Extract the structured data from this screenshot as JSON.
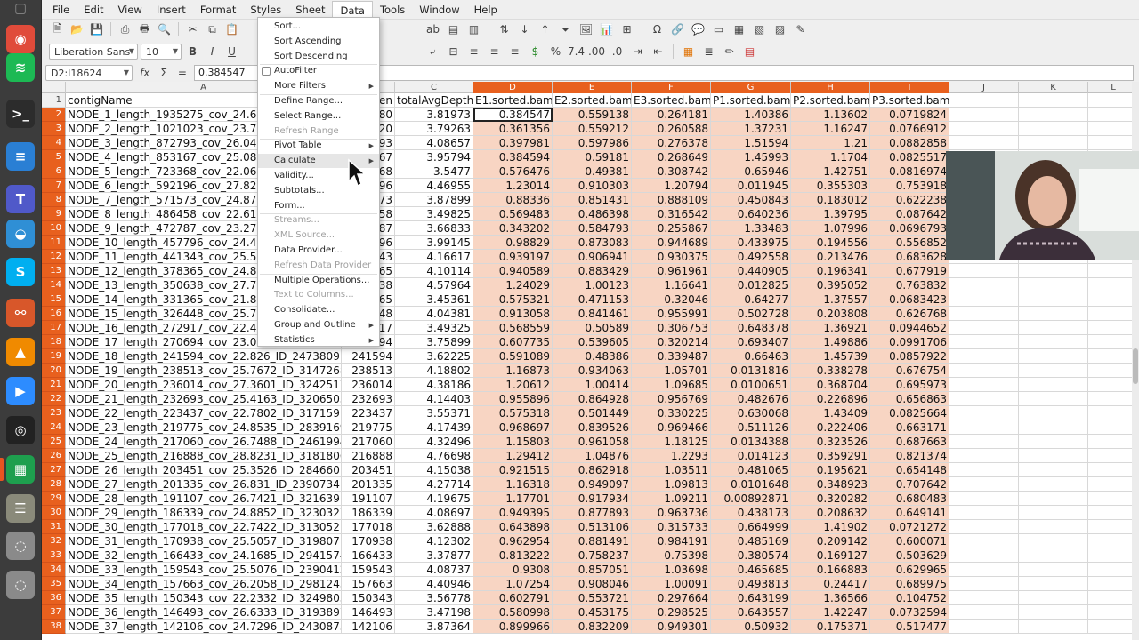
{
  "dock": {
    "items": [
      {
        "name": "files-icon",
        "glyph": "▢",
        "color": "#5a5a5a"
      },
      {
        "name": "chrome-icon",
        "glyph": "◉",
        "color": "#e04b3a"
      },
      {
        "name": "spotify-icon",
        "glyph": "≋",
        "color": "#1db954"
      },
      {
        "name": "terminal-icon",
        "glyph": ">_",
        "color": "#2c2c2c"
      },
      {
        "name": "writer-icon",
        "glyph": "≡",
        "color": "#2a7fd4"
      },
      {
        "name": "teams-icon",
        "glyph": "T",
        "color": "#5059c9"
      },
      {
        "name": "remote-icon",
        "glyph": "◒",
        "color": "#2f8fd5"
      },
      {
        "name": "skype-icon",
        "glyph": "S",
        "color": "#00aff0"
      },
      {
        "name": "network-icon",
        "glyph": "⚯",
        "color": "#d8572a"
      },
      {
        "name": "vlc-icon",
        "glyph": "▲",
        "color": "#f08a00"
      },
      {
        "name": "zoom-icon",
        "glyph": "▶",
        "color": "#2d8cff"
      },
      {
        "name": "obs-icon",
        "glyph": "◎",
        "color": "#222222"
      },
      {
        "name": "calc-icon",
        "glyph": "▦",
        "color": "#1e9f4e"
      },
      {
        "name": "archive-icon",
        "glyph": "☰",
        "color": "#8a8a7a"
      },
      {
        "name": "disk-icon",
        "glyph": "◌",
        "color": "#8a8a8a"
      },
      {
        "name": "disk2-icon",
        "glyph": "◌",
        "color": "#8a8a8a"
      }
    ]
  },
  "menubar": [
    "File",
    "Edit",
    "View",
    "Insert",
    "Format",
    "Styles",
    "Sheet",
    "Data",
    "Tools",
    "Window",
    "Help"
  ],
  "font": {
    "name": "Liberation Sans",
    "size": "10"
  },
  "formula": {
    "namebox": "D2:I18624",
    "symbols": "Σ",
    "equals": "=",
    "value": "0.384547"
  },
  "columns": [
    {
      "label": "A",
      "selected": false
    },
    {
      "label": "B",
      "selected": false
    },
    {
      "label": "C",
      "selected": false
    },
    {
      "label": "D",
      "selected": true
    },
    {
      "label": "E",
      "selected": true
    },
    {
      "label": "F",
      "selected": true
    },
    {
      "label": "G",
      "selected": true
    },
    {
      "label": "H",
      "selected": true
    },
    {
      "label": "I",
      "selected": true
    },
    {
      "label": "J",
      "selected": false
    },
    {
      "label": "K",
      "selected": false
    },
    {
      "label": "L",
      "selected": false
    }
  ],
  "header_row": [
    "contigName",
    "en",
    "totalAvgDepth",
    "E1.sorted.bam",
    "E2.sorted.bam",
    "E3.sorted.bam",
    "P1.sorted.bam",
    "P2.sorted.bam",
    "P3.sorted.bam"
  ],
  "rows": [
    [
      "NODE_1_length_1935275_cov_24.6",
      "280",
      "3.81973",
      "0.384547",
      "0.559138",
      "0.264181",
      "1.40386",
      "1.13602",
      "0.0719824"
    ],
    [
      "NODE_2_length_1021023_cov_23.7",
      "020",
      "3.79263",
      "0.361356",
      "0.559212",
      "0.260588",
      "1.37231",
      "1.16247",
      "0.0766912"
    ],
    [
      "NODE_3_length_872793_cov_26.04",
      "793",
      "4.08657",
      "0.397981",
      "0.597986",
      "0.276378",
      "1.51594",
      "1.21",
      "0.0882858"
    ],
    [
      "NODE_4_length_853167_cov_25.08",
      "167",
      "3.95794",
      "0.384594",
      "0.59181",
      "0.268649",
      "1.45993",
      "1.1704",
      "0.0825517"
    ],
    [
      "NODE_5_length_723368_cov_22.06",
      "368",
      "3.5477",
      "0.576476",
      "0.49381",
      "0.308742",
      "0.65946",
      "1.42751",
      "0.0816974"
    ],
    [
      "NODE_6_length_592196_cov_27.82",
      "196",
      "4.46955",
      "1.23014",
      "0.910303",
      "1.20794",
      "0.011945",
      "0.355303",
      "0.753918"
    ],
    [
      "NODE_7_length_571573_cov_24.87",
      "573",
      "3.87899",
      "0.88336",
      "0.851431",
      "0.888109",
      "0.450843",
      "0.183012",
      "0.622238"
    ],
    [
      "NODE_8_length_486458_cov_22.61",
      "458",
      "3.49825",
      "0.569483",
      "0.486398",
      "0.316542",
      "0.640236",
      "1.39795",
      "0.087642"
    ],
    [
      "NODE_9_length_472787_cov_23.27",
      "787",
      "3.66833",
      "0.343202",
      "0.584793",
      "0.255867",
      "1.33483",
      "1.07996",
      "0.0696793"
    ],
    [
      "NODE_10_length_457796_cov_24.4",
      "796",
      "3.99145",
      "0.98829",
      "0.873083",
      "0.944689",
      "0.433975",
      "0.194556",
      "0.556852"
    ],
    [
      "NODE_11_length_441343_cov_25.5",
      "343",
      "4.16617",
      "0.939197",
      "0.906941",
      "0.930375",
      "0.492558",
      "0.213476",
      "0.683628"
    ],
    [
      "NODE_12_length_378365_cov_24.8",
      "365",
      "4.10114",
      "0.940589",
      "0.883429",
      "0.961961",
      "0.440905",
      "0.196341",
      "0.677919"
    ],
    [
      "NODE_13_length_350638_cov_27.7",
      "638",
      "4.57964",
      "1.24029",
      "1.00123",
      "1.16641",
      "0.012825",
      "0.395052",
      "0.763832"
    ],
    [
      "NODE_14_length_331365_cov_21.8",
      "365",
      "3.45361",
      "0.575321",
      "0.471153",
      "0.32046",
      "0.64277",
      "1.37557",
      "0.0683423"
    ],
    [
      "NODE_15_length_326448_cov_25.7",
      "448",
      "4.04381",
      "0.913058",
      "0.841461",
      "0.955991",
      "0.502728",
      "0.203808",
      "0.626768"
    ],
    [
      "NODE_16_length_272917_cov_22.4",
      "917",
      "3.49325",
      "0.568559",
      "0.50589",
      "0.306753",
      "0.648378",
      "1.36921",
      "0.0944652"
    ],
    [
      "NODE_17_length_270694_cov_23.0",
      "594",
      "3.75899",
      "0.607735",
      "0.539605",
      "0.320214",
      "0.693407",
      "1.49886",
      "0.0991706"
    ],
    [
      "NODE_18_length_241594_cov_22.826_ID_2473809",
      "241594",
      "3.62225",
      "0.591089",
      "0.48386",
      "0.339487",
      "0.66463",
      "1.45739",
      "0.0857922"
    ],
    [
      "NODE_19_length_238513_cov_25.7672_ID_3147268",
      "238513",
      "4.18802",
      "1.16873",
      "0.934063",
      "1.05701",
      "0.0131816",
      "0.338278",
      "0.676754"
    ],
    [
      "NODE_20_length_236014_cov_27.3601_ID_3242517",
      "236014",
      "4.38186",
      "1.20612",
      "1.00414",
      "1.09685",
      "0.0100651",
      "0.368704",
      "0.695973"
    ],
    [
      "NODE_21_length_232693_cov_25.4163_ID_3206503",
      "232693",
      "4.14403",
      "0.955896",
      "0.864928",
      "0.956769",
      "0.482676",
      "0.226896",
      "0.656863"
    ],
    [
      "NODE_22_length_223437_cov_22.7802_ID_3171591",
      "223437",
      "3.55371",
      "0.575318",
      "0.501449",
      "0.330225",
      "0.630068",
      "1.43409",
      "0.0825664"
    ],
    [
      "NODE_23_length_219775_cov_24.8535_ID_2839169",
      "219775",
      "4.17439",
      "0.968697",
      "0.839526",
      "0.969466",
      "0.511126",
      "0.222406",
      "0.663171"
    ],
    [
      "NODE_24_length_217060_cov_26.7488_ID_2461994",
      "217060",
      "4.32496",
      "1.15803",
      "0.961058",
      "1.18125",
      "0.0134388",
      "0.323526",
      "0.687663"
    ],
    [
      "NODE_25_length_216888_cov_28.8231_ID_3181806",
      "216888",
      "4.76698",
      "1.29412",
      "1.04876",
      "1.2293",
      "0.014123",
      "0.359291",
      "0.821374"
    ],
    [
      "NODE_26_length_203451_cov_25.3526_ID_2846601",
      "203451",
      "4.15038",
      "0.921515",
      "0.862918",
      "1.03511",
      "0.481065",
      "0.195621",
      "0.654148"
    ],
    [
      "NODE_27_length_201335_cov_26.831_ID_2390734",
      "201335",
      "4.27714",
      "1.16318",
      "0.949097",
      "1.09813",
      "0.0101648",
      "0.348923",
      "0.707642"
    ],
    [
      "NODE_28_length_191107_cov_26.7421_ID_3216391",
      "191107",
      "4.19675",
      "1.17701",
      "0.917934",
      "1.09211",
      "0.00892871",
      "0.320282",
      "0.680483"
    ],
    [
      "NODE_29_length_186339_cov_24.8852_ID_3230327",
      "186339",
      "4.08697",
      "0.949395",
      "0.877893",
      "0.963736",
      "0.438173",
      "0.208632",
      "0.649141"
    ],
    [
      "NODE_30_length_177018_cov_22.7422_ID_3130521",
      "177018",
      "3.62888",
      "0.643898",
      "0.513106",
      "0.315733",
      "0.664999",
      "1.41902",
      "0.0721272"
    ],
    [
      "NODE_31_length_170938_cov_25.5057_ID_3198071",
      "170938",
      "4.12302",
      "0.962954",
      "0.881491",
      "0.984191",
      "0.485169",
      "0.209142",
      "0.600071"
    ],
    [
      "NODE_32_length_166433_cov_24.1685_ID_2941574",
      "166433",
      "3.37877",
      "0.813222",
      "0.758237",
      "0.75398",
      "0.380574",
      "0.169127",
      "0.503629"
    ],
    [
      "NODE_33_length_159543_cov_25.5076_ID_2390412",
      "159543",
      "4.08737",
      "0.9308",
      "0.857051",
      "1.03698",
      "0.465685",
      "0.166883",
      "0.629965"
    ],
    [
      "NODE_34_length_157663_cov_26.2058_ID_2981243",
      "157663",
      "4.40946",
      "1.07254",
      "0.908046",
      "1.00091",
      "0.493813",
      "0.24417",
      "0.689975"
    ],
    [
      "NODE_35_length_150343_cov_22.2332_ID_3249803",
      "150343",
      "3.56778",
      "0.602791",
      "0.553721",
      "0.297664",
      "0.643199",
      "1.36566",
      "0.104752"
    ],
    [
      "NODE_36_length_146493_cov_26.6333_ID_3193897",
      "146493",
      "3.47198",
      "0.580998",
      "0.453175",
      "0.298525",
      "0.643557",
      "1.42247",
      "0.0732594"
    ],
    [
      "NODE_37_length_142106_cov_24.7296_ID_2430873",
      "142106",
      "3.87364",
      "0.899966",
      "0.832209",
      "0.949301",
      "0.50932",
      "0.175371",
      "0.517477"
    ]
  ],
  "data_menu": [
    {
      "label": "Sort...",
      "disabled": false,
      "submenu": false
    },
    {
      "label": "Sort Ascending",
      "disabled": false,
      "submenu": false
    },
    {
      "label": "Sort Descending",
      "disabled": false,
      "submenu": false
    },
    {
      "sep": true
    },
    {
      "label": "AutoFilter",
      "disabled": false,
      "submenu": false,
      "check": true
    },
    {
      "label": "More Filters",
      "disabled": false,
      "submenu": true
    },
    {
      "sep": true
    },
    {
      "label": "Define Range...",
      "disabled": false,
      "submenu": false
    },
    {
      "label": "Select Range...",
      "disabled": false,
      "submenu": false
    },
    {
      "label": "Refresh Range",
      "disabled": true,
      "submenu": false
    },
    {
      "sep": true
    },
    {
      "label": "Pivot Table",
      "disabled": false,
      "submenu": true
    },
    {
      "label": "Calculate",
      "disabled": false,
      "submenu": true,
      "hover": true
    },
    {
      "label": "Validity...",
      "disabled": false,
      "submenu": false
    },
    {
      "label": "Subtotals...",
      "disabled": false,
      "submenu": false
    },
    {
      "label": "Form...",
      "disabled": false,
      "submenu": false
    },
    {
      "sep": true
    },
    {
      "label": "Streams...",
      "disabled": true,
      "submenu": false
    },
    {
      "label": "XML Source...",
      "disabled": true,
      "submenu": false
    },
    {
      "label": "Data Provider...",
      "disabled": false,
      "submenu": false
    },
    {
      "label": "Refresh Data Provider",
      "disabled": true,
      "submenu": false
    },
    {
      "sep": true
    },
    {
      "label": "Multiple Operations...",
      "disabled": false,
      "submenu": false
    },
    {
      "label": "Text to Columns...",
      "disabled": true,
      "submenu": false
    },
    {
      "label": "Consolidate...",
      "disabled": false,
      "submenu": false
    },
    {
      "label": "Group and Outline",
      "disabled": false,
      "submenu": true
    },
    {
      "label": "Statistics",
      "disabled": false,
      "submenu": true
    }
  ],
  "colors": {
    "selection_header": "#e8601e",
    "selection_fill": "#f8d5c3"
  }
}
